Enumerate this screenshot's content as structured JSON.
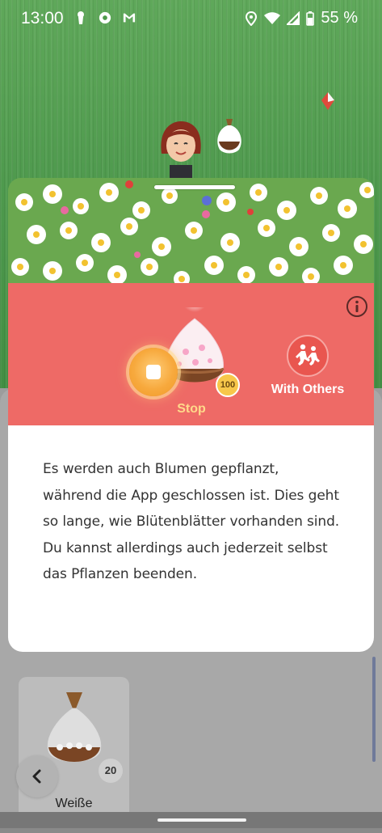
{
  "status_bar": {
    "time": "13:00",
    "left_icons": [
      "keyhole-icon",
      "chrome-icon",
      "gmail-icon"
    ],
    "right_icons": [
      "location-icon",
      "wifi-icon",
      "signal-icon",
      "battery-icon"
    ],
    "battery": "55 %"
  },
  "planting": {
    "stop_label": "Stop",
    "petal_count": "100",
    "with_others_label": "With Others",
    "accent_color": "#ee6a66"
  },
  "description": "Es werden auch Blumen gepflanzt, während die App geschlossen ist. Dies geht so lange, wie Blütenblätter vorhanden sind. Du kannst allerdings auch jederzeit selbst das Pflanzen beenden.",
  "inventory": {
    "item_name": "Weiße Blütenblätter",
    "item_count": "20"
  }
}
